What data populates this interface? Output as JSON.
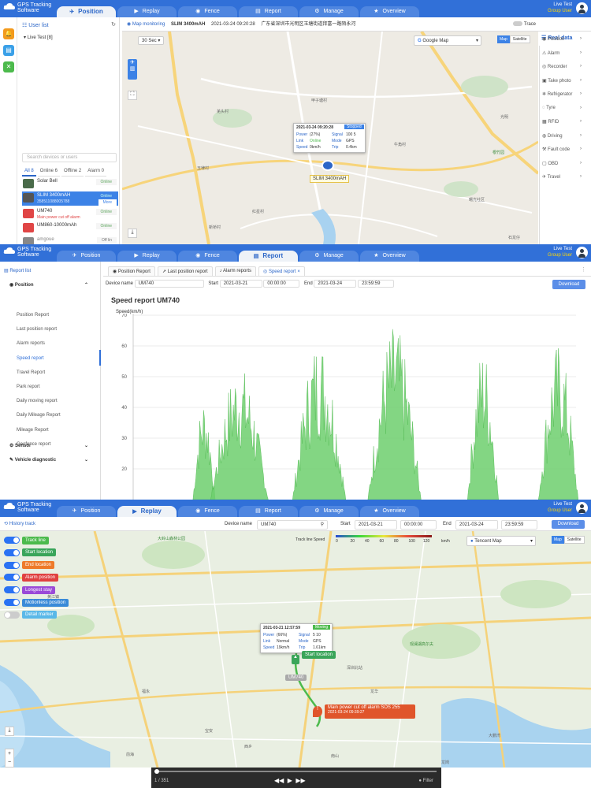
{
  "brand": {
    "line1": "GPS Tracking",
    "line2": "Software"
  },
  "tabs": [
    {
      "label": "Position",
      "icon": "✈"
    },
    {
      "label": "Replay",
      "icon": "▶"
    },
    {
      "label": "Fence",
      "icon": "◉"
    },
    {
      "label": "Report",
      "icon": "▤"
    },
    {
      "label": "Manage",
      "icon": "⚙"
    },
    {
      "label": "Overview",
      "icon": "★"
    }
  ],
  "user": {
    "name": "Live Test",
    "group": "Group User"
  },
  "panel1": {
    "user_list_title": "User list",
    "tree_item": "Live Test",
    "tree_count": "[8]",
    "map_title": "Map monitoring",
    "device": "SLIM 3400mAH",
    "timestamp": "2021-03-24 09:20:28",
    "address": "广东省深圳市光明区玉塘街道拜富一路陌永河",
    "trace_label": "Trace",
    "refresh": "30 Sec",
    "map_provider": "Google Map",
    "map_btn": "Map",
    "satellite_btn": "Satellite",
    "search_placeholder": "Search devices or users",
    "filters": [
      "All 8",
      "Online 6",
      "Offline 2",
      "Alarm 0"
    ],
    "devices": [
      {
        "name": "Solar Bell",
        "sub": "",
        "status": "Online",
        "color": "#4a6b4a"
      },
      {
        "name": "SLIM 3400mAH",
        "sub": "358511088005788",
        "status": "Online",
        "more": "More",
        "color": "#555"
      },
      {
        "name": "UM740",
        "sub": "Main power cut off alarm",
        "status": "Online",
        "color": "#e04545"
      },
      {
        "name": "UM860-10000mAh",
        "sub": "",
        "status": "Online",
        "color": "#777"
      },
      {
        "name": "amgoue",
        "sub": "",
        "status": "Off lin",
        "color": "#888"
      }
    ],
    "popup": {
      "time": "2021-03-24 09:20:28",
      "state": "Stopped",
      "power_label": "Power",
      "power_value": "(27%)",
      "signal_label": "Signal",
      "signal_value": "100  5",
      "link_label": "Link",
      "link_value": "Online",
      "mode_label": "Mode",
      "mode_value": "GPS",
      "speed_label": "Speed",
      "speed_value": "0km/h",
      "trip_label": "Trip",
      "trip_value": "0.4km"
    },
    "marker_label": "SLIM 3400mAH",
    "right_title": "Real data",
    "right_items": [
      "Position",
      "Alarm",
      "Recorder",
      "Take photo",
      "Refrigerator",
      "Tyre",
      "RFID",
      "Driving",
      "Fault code",
      "OBD",
      "Travel"
    ],
    "map_labels": [
      "甲子塘村",
      "羌头村",
      "红星村",
      "石龙仔",
      "玉律村",
      "牛角村",
      "根竹园",
      "曙光社区",
      "新桥村",
      "光明"
    ]
  },
  "panel2": {
    "sidebar_title": "Report list",
    "group_position": "Position",
    "items": [
      "Position Report",
      "Last position report",
      "Alarm reports",
      "Speed report",
      "Travel Report",
      "Park report",
      "Daily moving report",
      "Daily Mileage Report",
      "Mileage Report",
      "Geofence report"
    ],
    "group_sensor": "Sensor",
    "group_vehicle": "Vehicle diagnostic",
    "subtabs": [
      "Position Report",
      "Last position report",
      "Alarm reports",
      "Speed report"
    ],
    "device_name_label": "Device name",
    "device_name": "UM740",
    "start_label": "Start",
    "start_date": "2021-03-21",
    "start_time": "00:00:00",
    "end_label": "End",
    "end_date": "2021-03-24",
    "end_time": "23:59:59",
    "download": "Download",
    "chart_title": "Speed report",
    "chart_device": "UM740"
  },
  "chart_data": {
    "type": "area",
    "title": "Speed report UM740",
    "ylabel": "Speed(km/h)",
    "xlabel": "",
    "ylim": [
      10,
      70
    ],
    "yticks": [
      20,
      30,
      40,
      50,
      60,
      70
    ],
    "bursts": [
      {
        "center": 0.16,
        "width": 0.05,
        "peak": 44
      },
      {
        "center": 0.24,
        "width": 0.13,
        "peak": 54
      },
      {
        "center": 0.42,
        "width": 0.12,
        "peak": 63
      },
      {
        "center": 0.59,
        "width": 0.12,
        "peak": 67
      },
      {
        "center": 0.79,
        "width": 0.07,
        "peak": 60
      },
      {
        "center": 0.96,
        "width": 0.09,
        "peak": 61
      }
    ],
    "color": "#6dcf6d"
  },
  "panel3": {
    "title": "History track",
    "device_name_label": "Device name",
    "device_name": "UM740",
    "start_label": "Start",
    "start_date": "2021-03-21",
    "start_time": "00:00:00",
    "end_label": "End",
    "end_date": "2021-03-24",
    "end_time": "23:59:59",
    "download": "Download",
    "track_speed_label": "Track line Speed",
    "speed_scale": [
      "0",
      "20",
      "40",
      "60",
      "80",
      "100",
      "120"
    ],
    "speed_unit": "km/h",
    "map_provider": "Tencent Map",
    "map_btn": "Map",
    "satellite_btn": "Satellite",
    "options": [
      {
        "label": "Track line",
        "color": "#4cba4c",
        "on": true
      },
      {
        "label": "Start location",
        "color": "#3aa55a",
        "on": true
      },
      {
        "label": "End location",
        "color": "#ee7a2a",
        "on": true
      },
      {
        "label": "Alarm position",
        "color": "#e04040",
        "on": true
      },
      {
        "label": "Longest stay",
        "color": "#9a4ad8",
        "on": true
      },
      {
        "label": "Motionless position",
        "color": "#3a8ad8",
        "on": true
      },
      {
        "label": "Detail marker",
        "color": "#5ab8e8",
        "on": false
      }
    ],
    "popup": {
      "time": "2021-03-21 12:57:59",
      "state": "Moving",
      "power_label": "Power",
      "power_value": "(66%)",
      "signal_label": "Signal",
      "signal_value": "5  10",
      "link_label": "Link",
      "link_value": "Normal",
      "mode_label": "Mode",
      "mode_value": "GPS",
      "speed_label": "Speed",
      "speed_value": "19km/h",
      "trip_label": "Trip",
      "trip_value": "1.61km"
    },
    "start_tag": "Start location",
    "device_tag": "UM740",
    "alarm_tag": "Main power cut off alarm",
    "alarm_sos": "SOS 255",
    "alarm_time": "2021-03-24 09:39:27",
    "player_count": "1 / 351",
    "filter_label": "Filter",
    "map_labels": [
      "大岭山森林公园",
      "黄江镇",
      "观澜湖高尔夫",
      "大鹏湾",
      "龙华",
      "宝安",
      "福永",
      "西乡",
      "南山",
      "前海",
      "深圳北站",
      "龙岗"
    ]
  }
}
